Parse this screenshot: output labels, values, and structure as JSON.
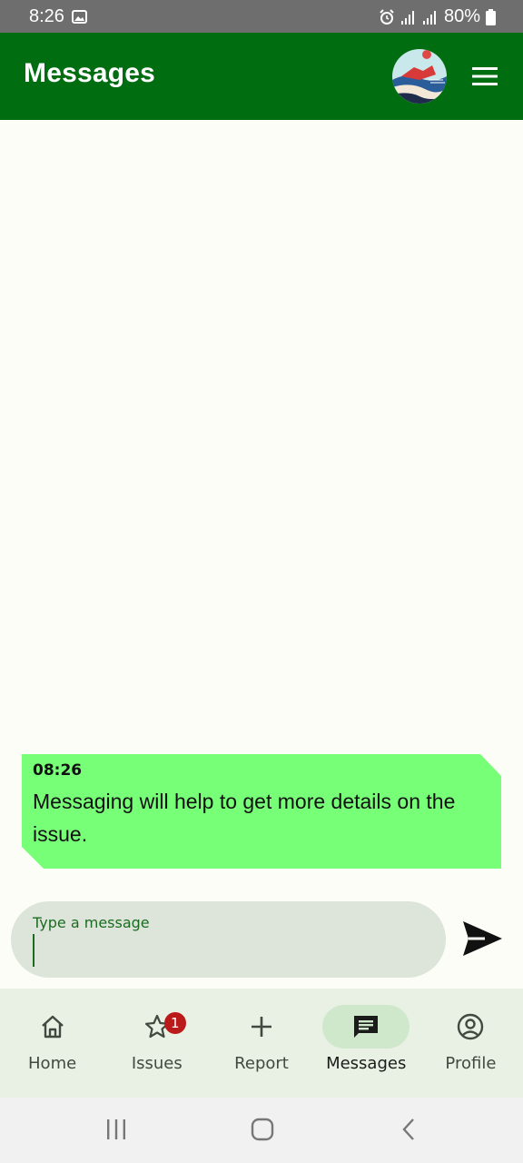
{
  "status_bar": {
    "time": "8:26",
    "battery": "80%",
    "icons": [
      "image-icon",
      "alarm-icon",
      "signal-icon",
      "signal-icon",
      "battery-icon"
    ]
  },
  "app_bar": {
    "title": "Messages",
    "background_color": "#006d11",
    "menu_icon": "hamburger-menu-icon"
  },
  "messages": [
    {
      "time": "08:26",
      "text": "Messaging will help to get more details on the issue.",
      "bubble_color": "#78ff78"
    }
  ],
  "composer": {
    "placeholder": "Type a message",
    "value": "",
    "send_icon": "send-icon"
  },
  "bottom_nav": {
    "items": [
      {
        "label": "Home",
        "icon": "home-icon",
        "active": false
      },
      {
        "label": "Issues",
        "icon": "star-icon",
        "active": false,
        "badge": "1"
      },
      {
        "label": "Report",
        "icon": "plus-icon",
        "active": false
      },
      {
        "label": "Messages",
        "icon": "message-icon",
        "active": true
      },
      {
        "label": "Profile",
        "icon": "profile-icon",
        "active": false
      }
    ],
    "active_color": "#cfe8cc",
    "badge_color": "#ba1a1a"
  },
  "system_nav": {
    "icons": [
      "recent-apps-icon",
      "home-circle-icon",
      "back-icon"
    ]
  }
}
